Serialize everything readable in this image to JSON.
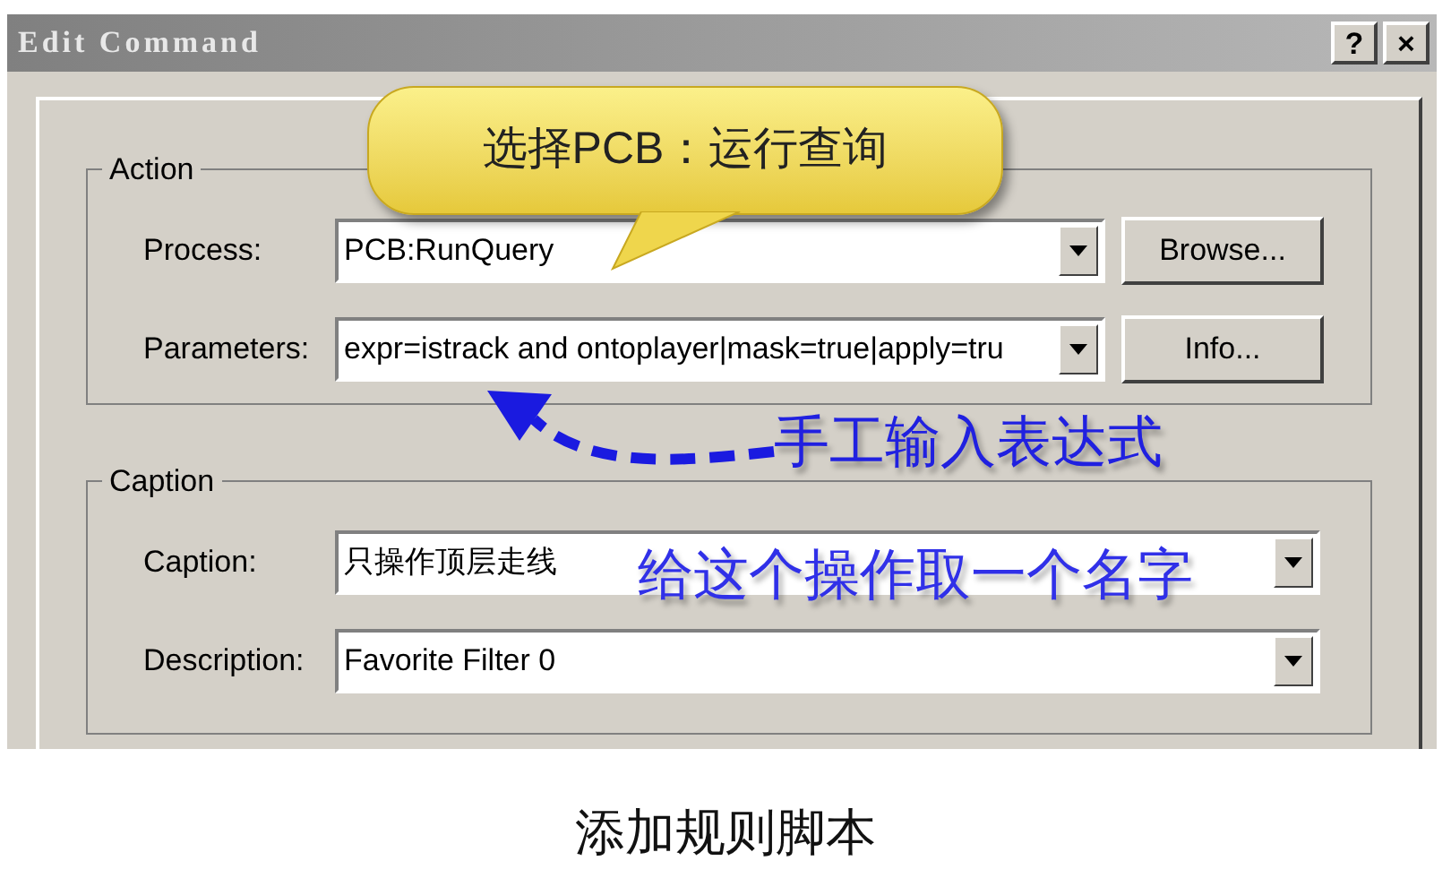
{
  "window": {
    "title": "Edit Command",
    "buttons": [
      "?",
      "×"
    ]
  },
  "groups": [
    {
      "title": "Action",
      "rows": [
        {
          "label": "Process:",
          "value": "PCB:RunQuery",
          "button": "Browse..."
        },
        {
          "label": "Parameters:",
          "value": "expr=istrack and ontoplayer|mask=true|apply=tru",
          "button": "Info..."
        }
      ]
    },
    {
      "title": "Caption",
      "rows": [
        {
          "label": "Caption:",
          "value": "只操作顶层走线"
        },
        {
          "label": "Description:",
          "value": "Favorite Filter 0"
        }
      ]
    }
  ],
  "annotations": {
    "callout": "选择PCB：运行查询",
    "arrow_note": "手工输入表达式",
    "name_note": "给这个操作取一个名字"
  },
  "figure_caption": "添加规则脚本"
}
